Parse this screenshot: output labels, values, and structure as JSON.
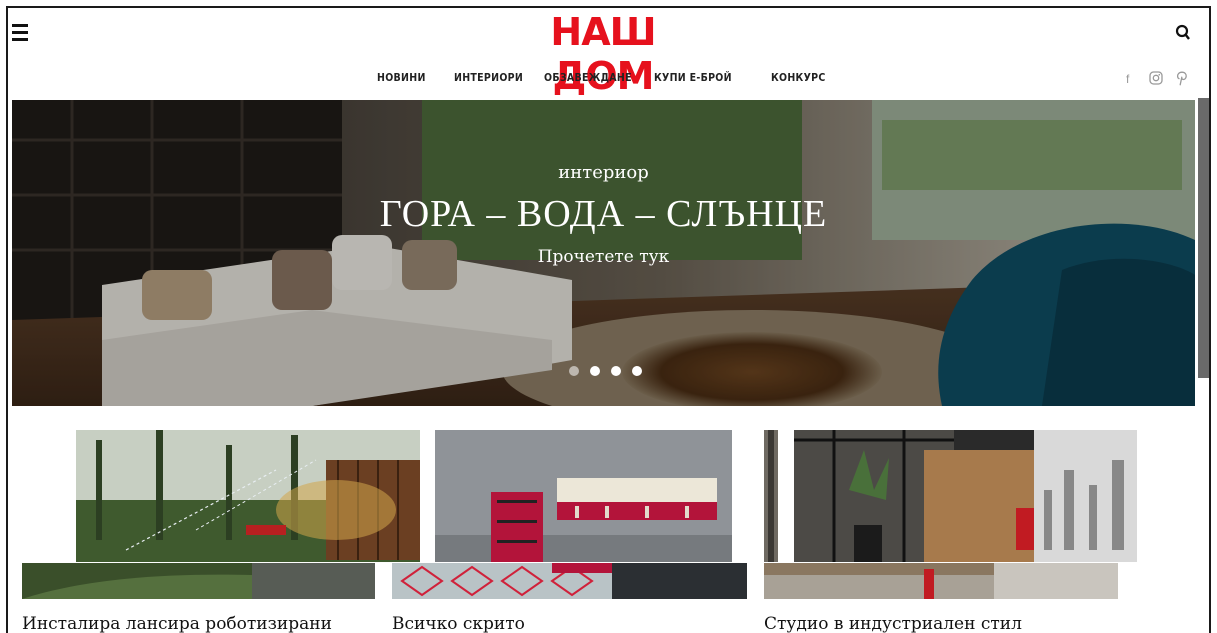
{
  "header": {
    "logo": "НАШ ДОМ",
    "menu_icon": "hamburger-menu-icon",
    "search_icon": "search-icon"
  },
  "nav": {
    "items": [
      {
        "label": "НОВИНИ"
      },
      {
        "label": "ИНТЕРИОРИ"
      },
      {
        "label": "ОБЗАВЕЖДАНЕ"
      },
      {
        "label": "КУПИ Е-БРОЙ"
      },
      {
        "label": "КОНКУРС"
      }
    ]
  },
  "social": {
    "facebook": "f",
    "instagram_icon": "instagram-icon",
    "pinterest_icon": "pinterest-icon"
  },
  "hero": {
    "kicker": "интериор",
    "title": "ГОРА – ВОДА – СЛЪНЦЕ",
    "cta": "Прочетете тук",
    "slides_count": 4,
    "active_slide": 2
  },
  "cards": [
    {
      "title": "Инсталира лансира роботизирани"
    },
    {
      "title": "Всичко скрито"
    },
    {
      "title": "Студио в индустриален стил"
    }
  ],
  "colors": {
    "brand_red": "#e6111d",
    "nav_text": "#222222",
    "social_gray": "#999999"
  }
}
